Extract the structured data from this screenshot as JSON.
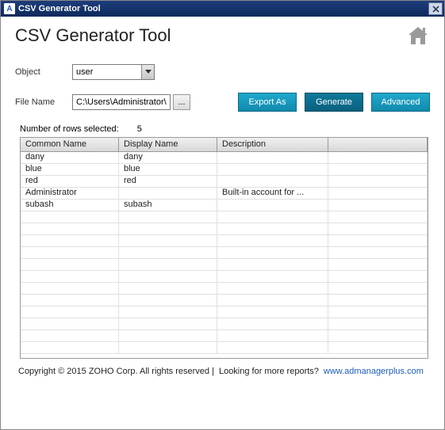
{
  "titlebar": {
    "app_icon_letter": "A",
    "title": "CSV Generator Tool"
  },
  "header": {
    "page_title": "CSV Generator Tool"
  },
  "form": {
    "object_label": "Object",
    "object_value": "user",
    "filename_label": "File Name",
    "filename_value": "C:\\Users\\Administrator\\",
    "browse_label": "..."
  },
  "buttons": {
    "export_as": "Export As",
    "generate": "Generate",
    "advanced": "Advanced"
  },
  "table": {
    "rows_selected_label": "Number of rows selected:",
    "rows_selected_count": "5",
    "columns": [
      "Common Name",
      "Display Name",
      "Description",
      ""
    ],
    "rows": [
      {
        "common_name": "dany",
        "display_name": "dany",
        "description": ""
      },
      {
        "common_name": "blue",
        "display_name": "blue",
        "description": ""
      },
      {
        "common_name": "red",
        "display_name": "red",
        "description": ""
      },
      {
        "common_name": "Administrator",
        "display_name": "",
        "description": "Built-in account for ..."
      },
      {
        "common_name": "subash",
        "display_name": "subash",
        "description": ""
      }
    ]
  },
  "footer": {
    "copyright": "Copyright © 2015 ZOHO Corp. All rights reserved |",
    "looking_text": "Looking for more reports?",
    "link_text": "www.admanagerplus.com"
  }
}
